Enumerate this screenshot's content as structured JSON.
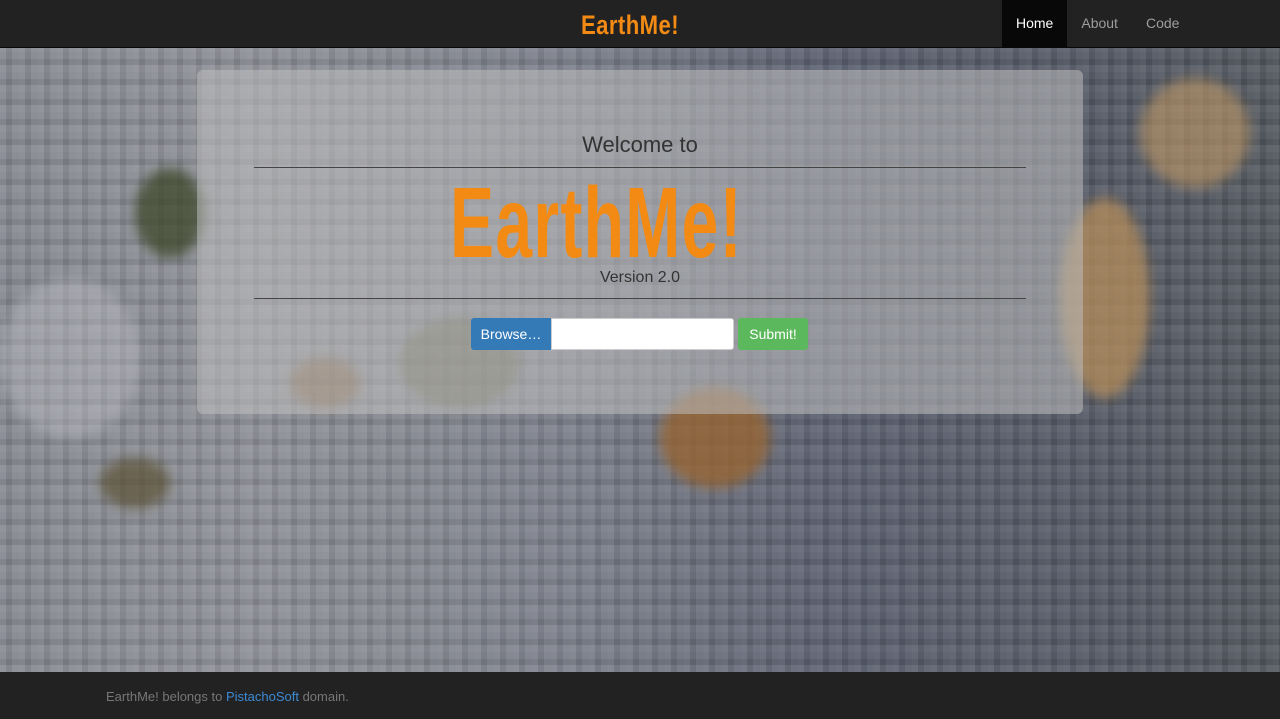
{
  "navbar": {
    "brand": "EarthMe!",
    "items": [
      {
        "label": "Home",
        "active": true
      },
      {
        "label": "About",
        "active": false
      },
      {
        "label": "Code",
        "active": false
      }
    ]
  },
  "hero": {
    "welcome": "Welcome to",
    "logo": "EarthMe!",
    "version": "Version 2.0"
  },
  "upload": {
    "browse_label": "Browse…",
    "file_value": "",
    "submit_label": "Submit!"
  },
  "footer": {
    "text_before": "EarthMe! belongs to ",
    "link": "PistachoSoft",
    "text_after": " domain."
  },
  "colors": {
    "brand_orange": "#f28a14",
    "navbar_bg": "#222222",
    "browse_blue": "#337ab7",
    "submit_green": "#5cb85c",
    "link_blue": "#3d8ad4"
  }
}
